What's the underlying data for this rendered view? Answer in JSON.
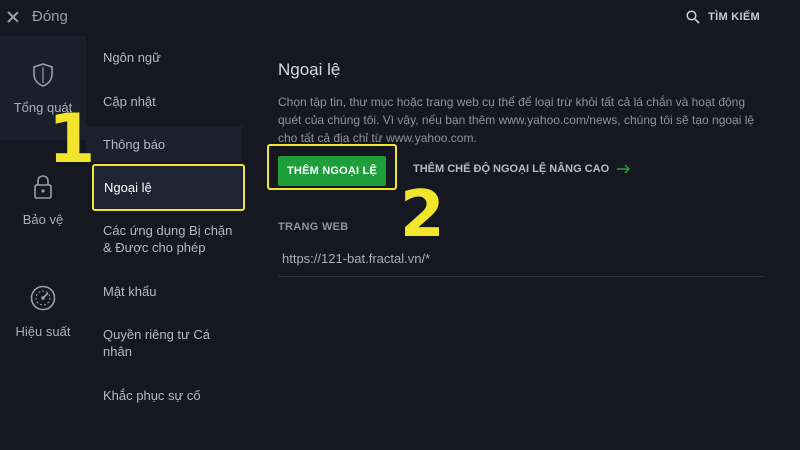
{
  "topbar": {
    "close_label": "Đóng",
    "search_label": "TÌM KIẾM"
  },
  "rail": {
    "items": [
      {
        "label": "Tổng quát",
        "icon": "shield-icon",
        "active": true
      },
      {
        "label": "Bảo vệ",
        "icon": "lock-icon",
        "active": false
      },
      {
        "label": "Hiệu suất",
        "icon": "speedometer-icon",
        "active": false
      }
    ]
  },
  "submenu": {
    "items": [
      {
        "label": "Ngôn ngữ"
      },
      {
        "label": "Cập nhật"
      },
      {
        "label": "Thông báo"
      },
      {
        "label": "Ngoại lệ",
        "active": true
      },
      {
        "label": "Các ứng dụng Bị chặn & Được cho phép"
      },
      {
        "label": "Mật khẩu"
      },
      {
        "label": "Quyền riêng tư Cá nhân"
      },
      {
        "label": "Khắc phục sự cố"
      }
    ]
  },
  "main": {
    "title": "Ngoại lệ",
    "description": "Chọn tập tin, thư mục hoặc trang web cụ thể để loại trừ khỏi tất cả lá chắn và hoạt động quét của chúng tôi. Vì vậy, nếu bạn thêm www.yahoo.com/news, chúng tôi sẽ tạo ngoại lệ cho tất cả địa chỉ từ www.yahoo.com.",
    "add_button": "THÊM NGOẠI LỆ",
    "advanced_link": "THÊM CHẾ ĐỘ NGOẠI LỆ NÂNG CAO",
    "section_label": "TRANG WEB",
    "website_value": "https://121-bat.fractal.vn/*"
  },
  "annotations": {
    "step_1": "1",
    "step_2": "2"
  },
  "colors": {
    "background": "#151821",
    "accent_green": "#1f9f3b",
    "highlight_yellow": "#f2e52b"
  }
}
